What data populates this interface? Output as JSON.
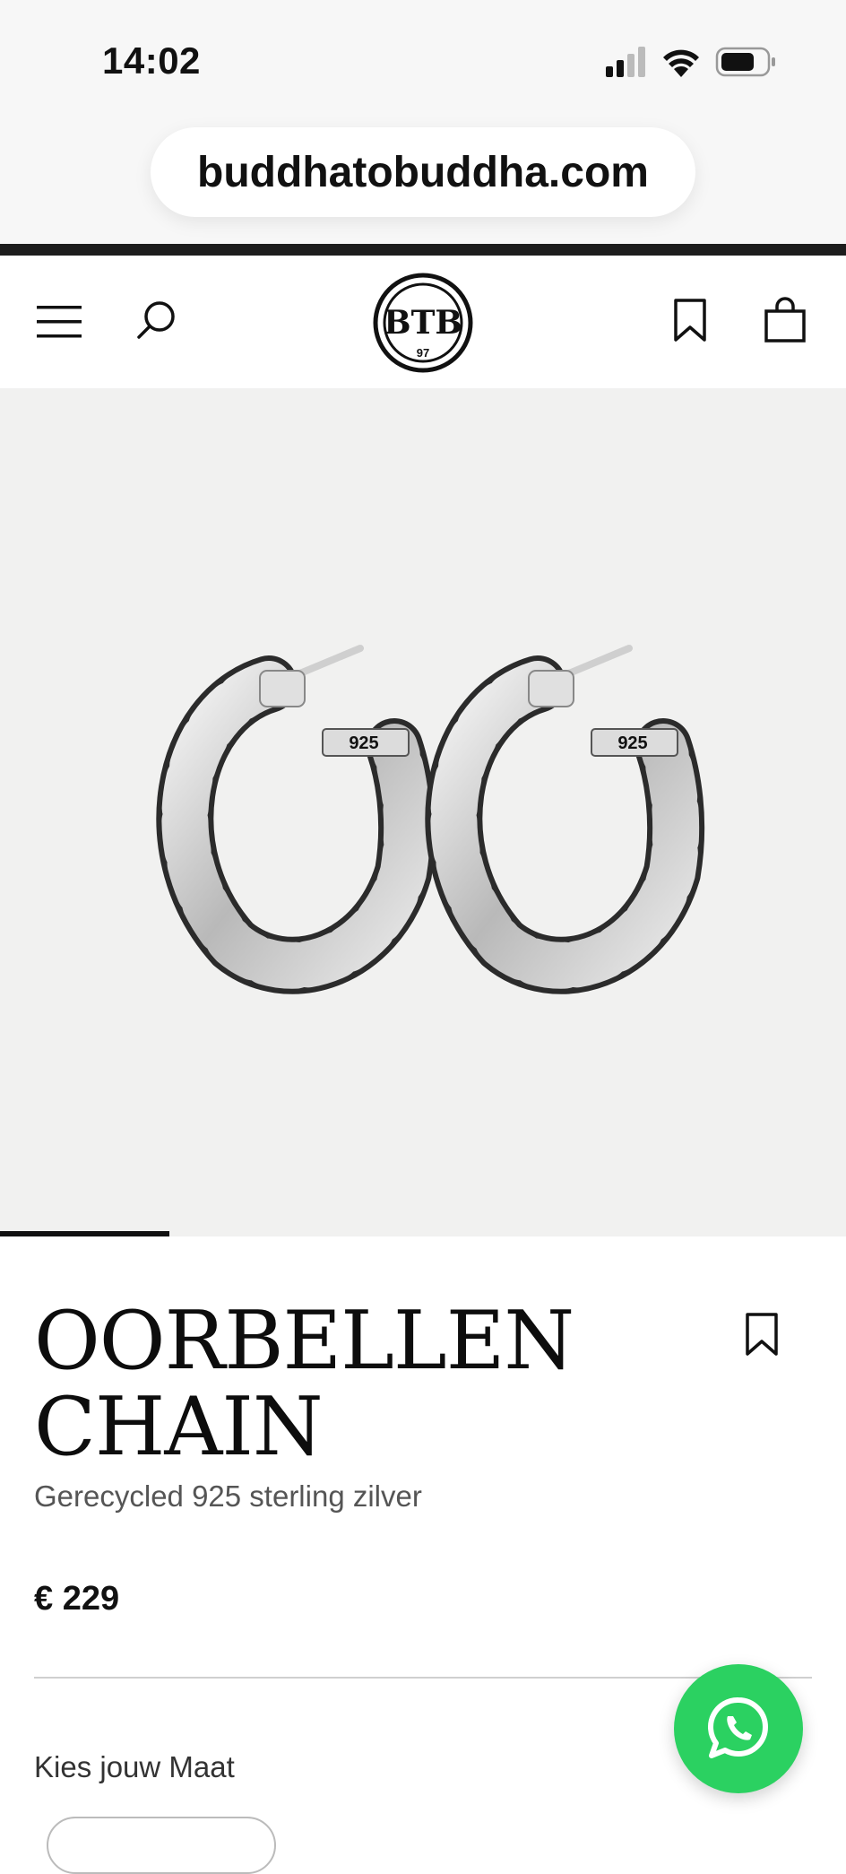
{
  "status_bar": {
    "time": "14:02",
    "icons": [
      "cellular-signal-icon",
      "wifi-icon",
      "battery-icon"
    ]
  },
  "browser": {
    "url": "buddhatobuddha.com"
  },
  "header": {
    "icons": [
      "menu-icon",
      "search-icon",
      "logo",
      "bookmark-icon",
      "shopping-bag-icon"
    ],
    "logo_text": "BTB",
    "logo_subtext": "97"
  },
  "gallery": {
    "image_alt_icon": "hoop-earrings",
    "earring_stamp": "925",
    "progress_fraction": 0.2
  },
  "product": {
    "title_line1": "OORBELLEN",
    "title_line2": "CHAIN",
    "subtitle": "Gerecycled 925 sterling zilver",
    "price": "€ 229",
    "size_label": "Kies jouw Maat"
  },
  "colors": {
    "accent_whatsapp": "#2bd161",
    "background_image": "#f1f1f0",
    "text": "#111111"
  }
}
